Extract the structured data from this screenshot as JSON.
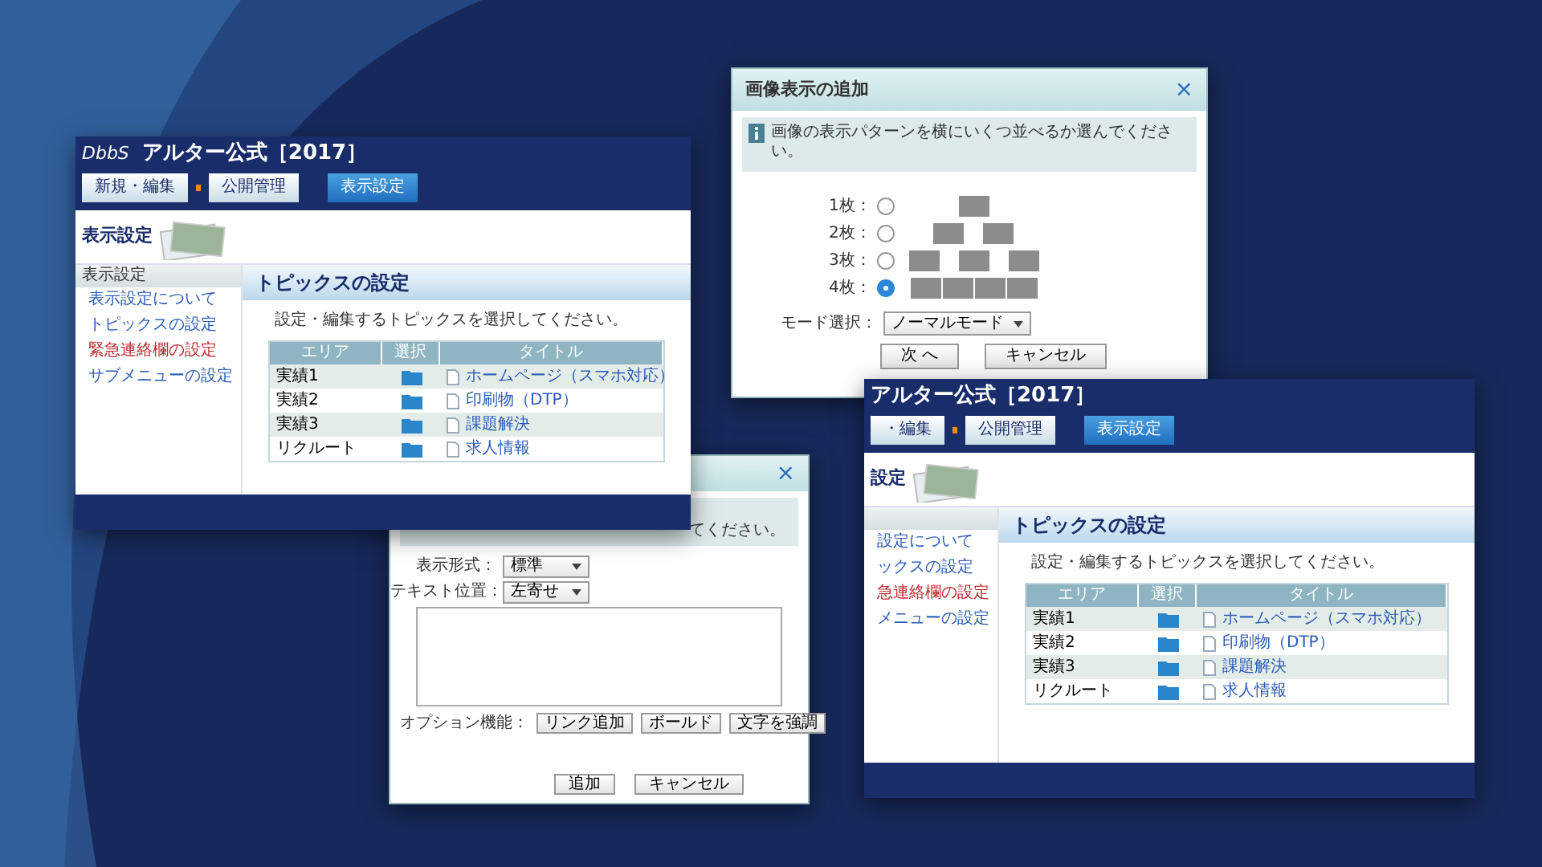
{
  "windows": [
    {
      "kind": "text_dialog",
      "close": "×",
      "message": "てください。",
      "fields": [
        {
          "label": "表示形式：",
          "value": "標準"
        },
        {
          "label": "テキスト位置：",
          "value": "左寄せ"
        }
      ],
      "options_label": "オプション機能：",
      "option_buttons": [
        "リンク追加",
        "ボールド",
        "文字を強調"
      ],
      "buttons": [
        "追加",
        "キャンセル"
      ]
    },
    {
      "kind": "app",
      "logo": "DbbS",
      "title": "アルター公式［2017］",
      "tabs": [
        {
          "label": "新規・編集",
          "selected": false
        },
        {
          "label": "公開管理",
          "selected": false
        },
        {
          "label": "表示設定",
          "selected": true
        }
      ],
      "page_heading": "表示設定",
      "sidebar": {
        "heading": "表示設定",
        "items": [
          {
            "label": "表示設定について",
            "highlighted": false
          },
          {
            "label": "トピックスの設定",
            "highlighted": false
          },
          {
            "label": "緊急連絡欄の設定",
            "highlighted": true
          },
          {
            "label": "サブメニューの設定",
            "highlighted": false
          }
        ]
      },
      "section_title": "トピックスの設定",
      "instruction": "設定・編集するトピックスを選択してください。",
      "table": {
        "columns": [
          "エリア",
          "選択",
          "タイトル"
        ],
        "rows": [
          {
            "area": "実績1",
            "title": "ホームページ（スマホ対応）"
          },
          {
            "area": "実績2",
            "title": "印刷物（DTP）"
          },
          {
            "area": "実績3",
            "title": "課題解決"
          },
          {
            "area": "リクルート",
            "title": "求人情報"
          }
        ]
      }
    },
    {
      "kind": "image_dialog",
      "title": "画像表示の追加",
      "close": "×",
      "message": "画像の表示パターンを横にいくつ並べるか選んでください。",
      "options": [
        {
          "label": "1枚：",
          "selected": false
        },
        {
          "label": "2枚：",
          "selected": false
        },
        {
          "label": "3枚：",
          "selected": false
        },
        {
          "label": "4枚：",
          "selected": true
        }
      ],
      "mode": {
        "label": "モード選択：",
        "value": "ノーマルモード"
      },
      "buttons": [
        "次 へ",
        "キャンセル"
      ]
    },
    {
      "kind": "app",
      "title": "アルター公式［2017］",
      "tabs": [
        {
          "label": "・編集",
          "selected": false
        },
        {
          "label": "公開管理",
          "selected": false
        },
        {
          "label": "表示設定",
          "selected": true
        }
      ],
      "page_heading": "設定",
      "sidebar": {
        "items": [
          {
            "label": "設定について",
            "highlighted": false
          },
          {
            "label": "ックスの設定",
            "highlighted": false
          },
          {
            "label": "急連絡欄の設定",
            "highlighted": true
          },
          {
            "label": "メニューの設定",
            "highlighted": false
          }
        ]
      },
      "section_title": "トピックスの設定",
      "instruction": "設定・編集するトピックスを選択してください。",
      "table": {
        "columns": [
          "エリア",
          "選択",
          "タイトル"
        ],
        "rows": [
          {
            "area": "実績1",
            "title": "ホームページ（スマホ対応）"
          },
          {
            "area": "実績2",
            "title": "印刷物（DTP）"
          },
          {
            "area": "実績3",
            "title": "課題解決"
          },
          {
            "area": "リクルート",
            "title": "求人情報"
          }
        ]
      }
    }
  ]
}
